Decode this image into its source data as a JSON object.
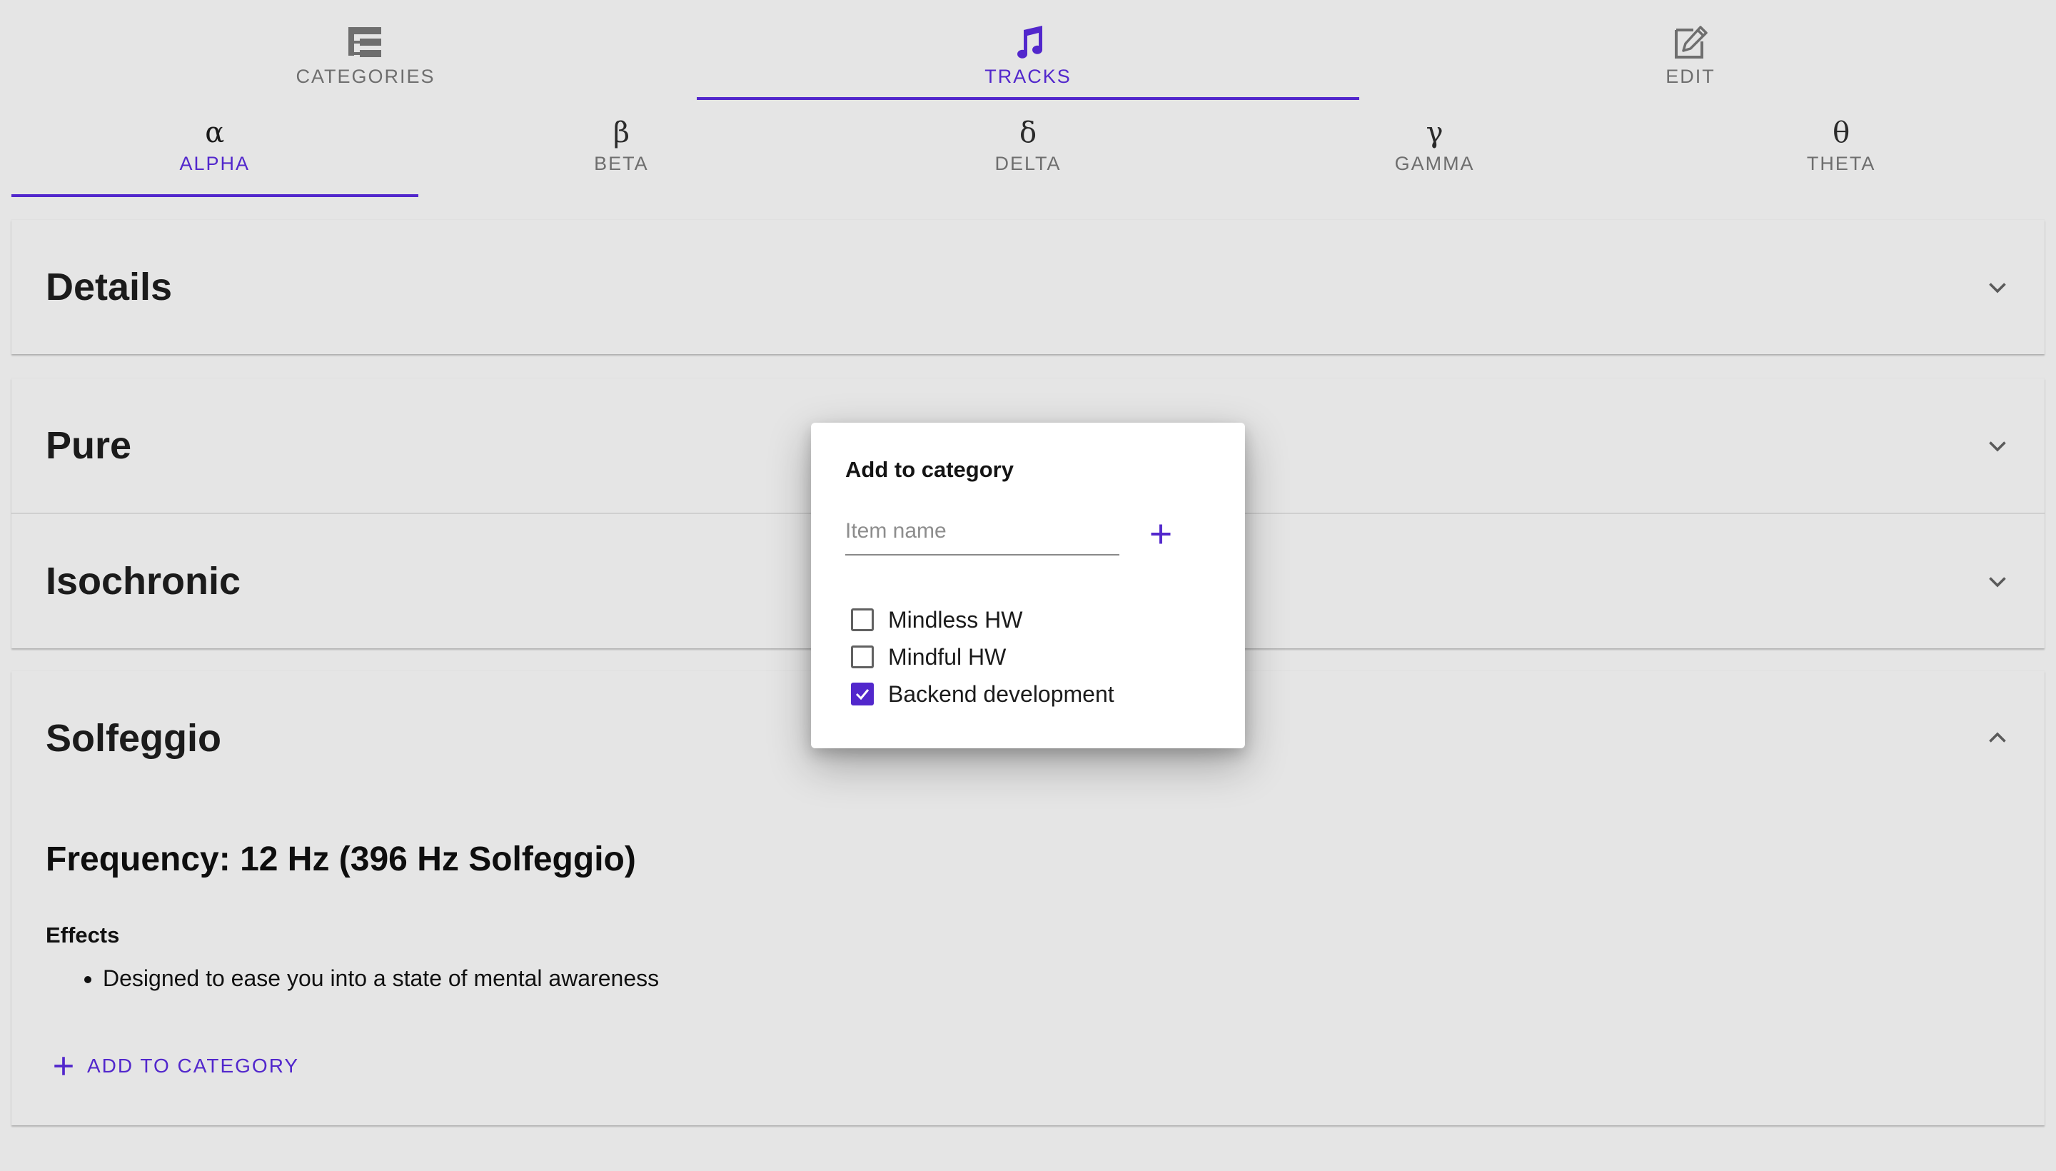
{
  "colors": {
    "accent": "#5227cc",
    "background": "#e5e5e5",
    "inactive_text": "#6e6e6e"
  },
  "top_nav": {
    "tabs": [
      {
        "label": "CATEGORIES",
        "icon": "categories-tree-icon",
        "active": false
      },
      {
        "label": "TRACKS",
        "icon": "music-note-icon",
        "active": true
      },
      {
        "label": "EDIT",
        "icon": "edit-pencil-icon",
        "active": false
      }
    ]
  },
  "band_nav": {
    "tabs": [
      {
        "symbol": "α",
        "label": "ALPHA",
        "active": true
      },
      {
        "symbol": "β",
        "label": "BETA",
        "active": false
      },
      {
        "symbol": "δ",
        "label": "DELTA",
        "active": false
      },
      {
        "symbol": "γ",
        "label": "GAMMA",
        "active": false
      },
      {
        "symbol": "θ",
        "label": "THETA",
        "active": false
      }
    ]
  },
  "panels": {
    "details": {
      "title": "Details",
      "expanded": false
    },
    "pure": {
      "title": "Pure",
      "expanded": false
    },
    "isochronic": {
      "title": "Isochronic",
      "expanded": false
    },
    "solfeggio": {
      "title": "Solfeggio",
      "expanded": true,
      "frequency": "Frequency: 12 Hz (396 Hz Solfeggio)",
      "effects_title": "Effects",
      "effects": [
        "Designed to ease you into a state of mental awareness"
      ],
      "add_to_category_label": "ADD TO CATEGORY"
    }
  },
  "dialog": {
    "title": "Add to category",
    "input_placeholder": "Item name",
    "input_value": "",
    "categories": [
      {
        "label": "Mindless HW",
        "checked": false
      },
      {
        "label": "Mindful HW",
        "checked": false
      },
      {
        "label": "Backend development",
        "checked": true
      }
    ]
  }
}
